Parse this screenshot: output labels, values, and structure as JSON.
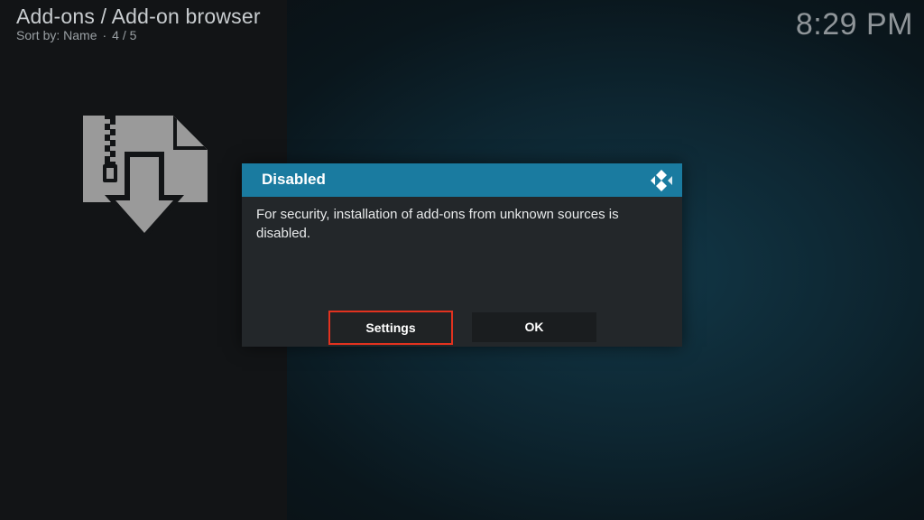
{
  "header": {
    "title": "Add-ons / Add-on browser",
    "sort_label": "Sort by: Name",
    "separator": "·",
    "position": "4 / 5"
  },
  "clock": "8:29 PM",
  "icons": {
    "addon_browser": "zip-download-icon",
    "kodi_logo": "kodi-logo-icon"
  },
  "dialog": {
    "title": "Disabled",
    "message": "For security, installation of add-ons from unknown sources is disabled.",
    "buttons": {
      "settings": "Settings",
      "ok": "OK"
    },
    "focused_button": "settings"
  },
  "colors": {
    "dialog_header": "#1a7ba0",
    "focus_border": "#e2321f",
    "dialog_body": "#23272a"
  }
}
